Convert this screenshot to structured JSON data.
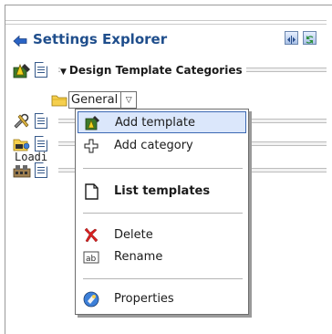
{
  "header": {
    "title": "Settings Explorer",
    "back_icon": "back-arrow-icon",
    "toolbar_icons": [
      "collapse-all-icon",
      "refresh-icon"
    ]
  },
  "categories": [
    {
      "icon": "design-templates-icon",
      "label": "Design Template Categories",
      "expanded": true
    },
    {
      "icon": "tools-icon",
      "label": ""
    },
    {
      "icon": "folder-connect-icon",
      "label": ""
    },
    {
      "icon": "machines-icon",
      "label": ""
    }
  ],
  "tree": {
    "general_label": "General",
    "loading_label": "Loadi"
  },
  "context_menu": {
    "items": [
      {
        "label": "Add template",
        "icon": "add-template-icon",
        "selected": true
      },
      {
        "label": "Add category",
        "icon": "add-category-icon",
        "selected": false
      },
      {
        "label": "List templates",
        "icon": "list-templates-icon",
        "selected": false,
        "bold": true
      },
      {
        "label": "Delete",
        "icon": "delete-icon",
        "selected": false
      },
      {
        "label": "Rename",
        "icon": "rename-icon",
        "selected": false
      },
      {
        "label": "Properties",
        "icon": "properties-icon",
        "selected": false
      }
    ]
  },
  "colors": {
    "title_text": "#1f4e8c",
    "menu_highlight_bg": "#dbe7fb",
    "menu_highlight_border": "#3c69b3"
  }
}
